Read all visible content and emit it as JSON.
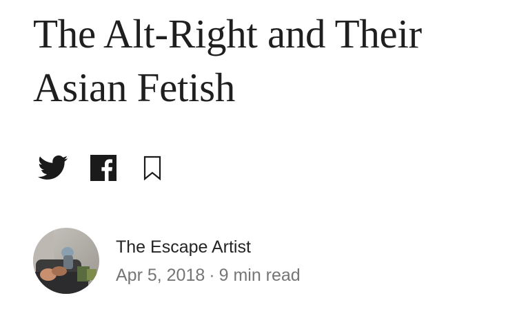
{
  "article": {
    "title": "The Alt-Right and Their Asian Fetish"
  },
  "share": {
    "twitter_icon": "twitter-bird-icon",
    "facebook_icon": "facebook-f-icon",
    "bookmark_icon": "bookmark-icon"
  },
  "author": {
    "name": "The Escape Artist",
    "avatar": "author-photo"
  },
  "meta": {
    "date": "Apr 5, 2018",
    "separator": "·",
    "read_time": "9 min read"
  },
  "colors": {
    "title": "#1f1f1f",
    "icon": "#1a1a1a",
    "author": "#242424",
    "meta": "#757575",
    "background": "#ffffff"
  }
}
